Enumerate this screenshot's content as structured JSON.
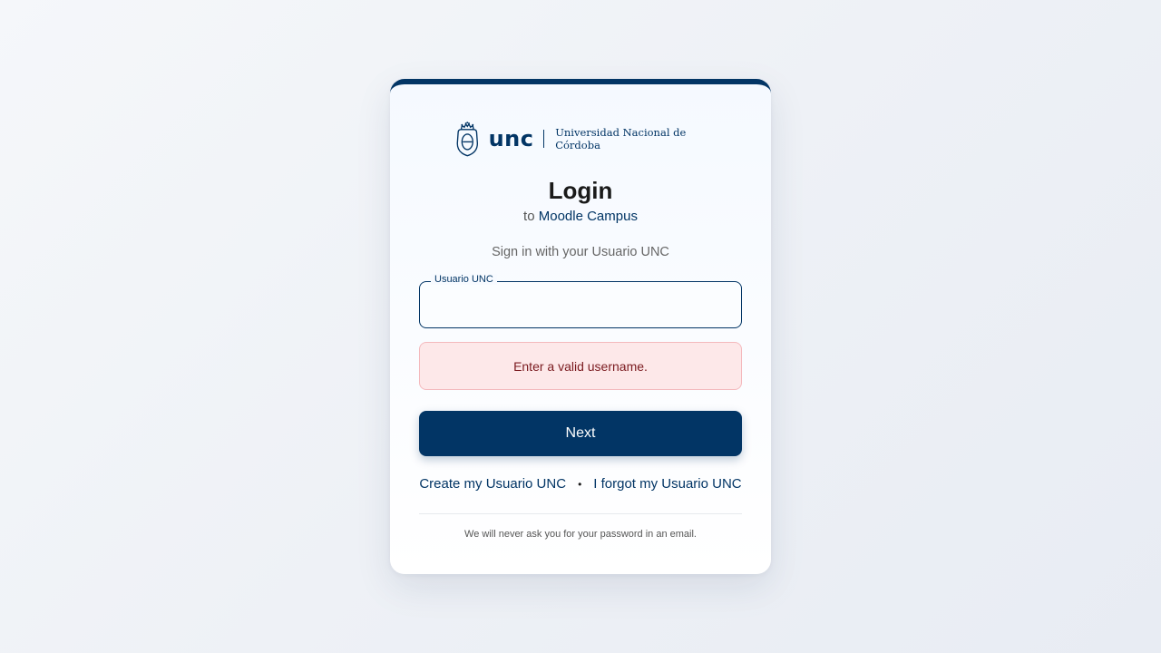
{
  "logo": {
    "wordmark": "unc",
    "institution": "Universidad Nacional de Córdoba",
    "icon": "university-crest-icon"
  },
  "heading": {
    "title": "Login",
    "subtitle_prefix": "to",
    "subtitle_brand": "Moodle Campus"
  },
  "form": {
    "hint": "Sign in with your Usuario UNC",
    "username_label": "Usuario UNC",
    "username_value": "",
    "error_message": "Enter a valid username.",
    "next_label": "Next"
  },
  "links": {
    "create": "Create my Usuario UNC",
    "separator": "•",
    "forgot": "I forgot my Usuario UNC"
  },
  "footer": {
    "note": "We will never ask you for your password in an email."
  },
  "colors": {
    "brand": "#023565",
    "error_bg": "#fde8e9",
    "error_text": "#7a1a1f"
  }
}
